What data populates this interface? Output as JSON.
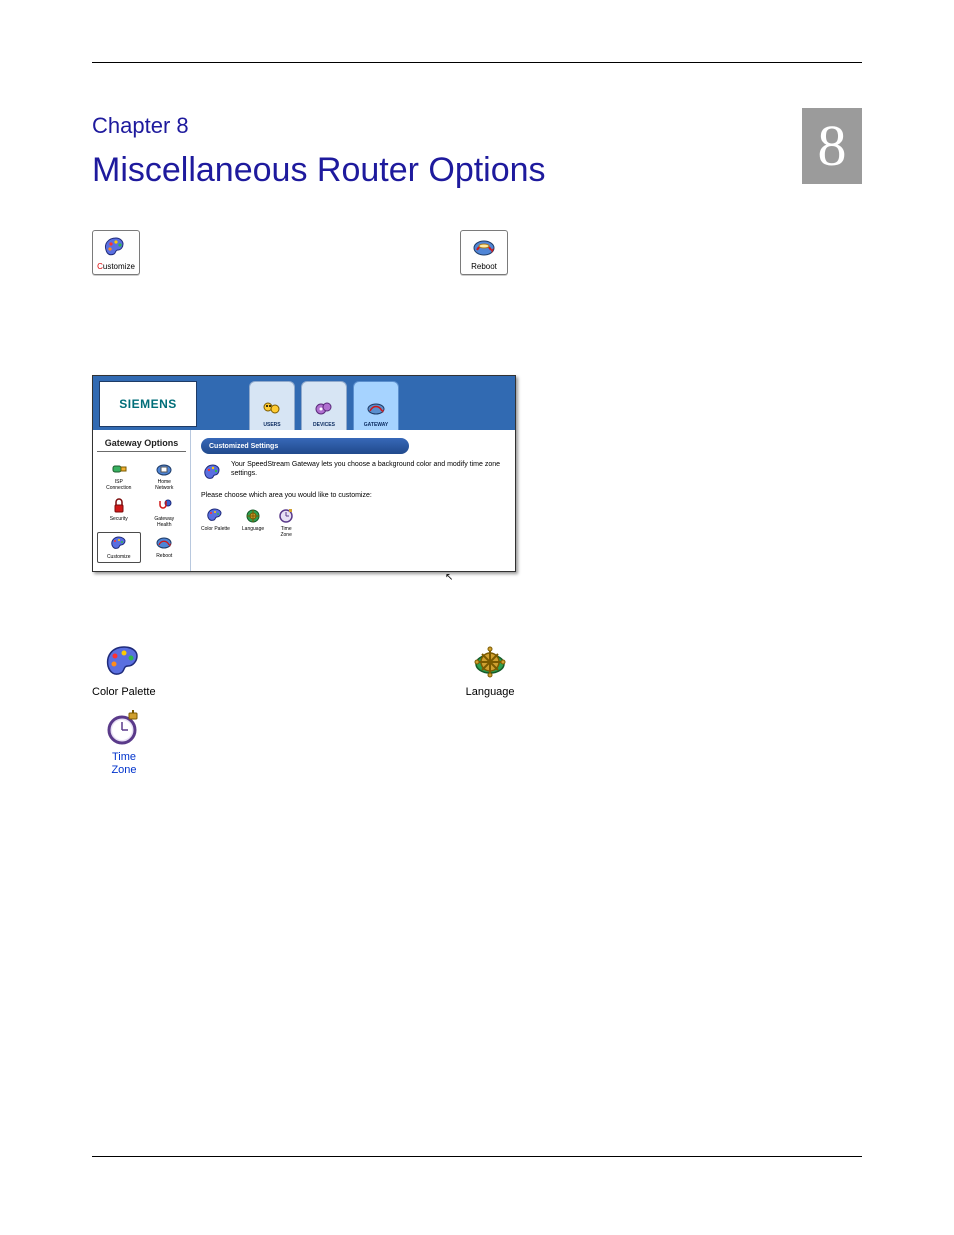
{
  "chapter_label": "Chapter 8",
  "chapter_title": "Miscellaneous Router Options",
  "chapter_number": "8",
  "tiles": {
    "customize_label": "Customize",
    "reboot_label": "Reboot"
  },
  "screenshot": {
    "logo": "SIEMENS",
    "tabs": {
      "users": "USERS",
      "devices": "DEVICES",
      "gateway": "GATEWAY"
    },
    "sidebar": {
      "title": "Gateway Options",
      "isp": "ISP\nConnection",
      "home": "Home\nNetwork",
      "security": "Security",
      "health": "Gateway\nHealth",
      "customize": "Customize",
      "reboot": "Reboot"
    },
    "bar_title": "Customized Settings",
    "intro": "Your SpeedStream Gateway lets you choose a background color and modify time zone settings.",
    "prompt": "Please choose which area you would like to customize:",
    "opts": {
      "palette": "Color Palette",
      "language": "Language",
      "tz": "Time\nZone"
    }
  },
  "bottom": {
    "palette": "Color Palette",
    "language": "Language",
    "tz1": "Time",
    "tz2": "Zone"
  }
}
